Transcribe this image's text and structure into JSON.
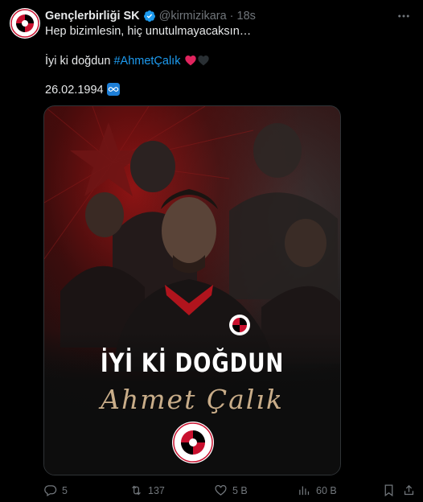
{
  "author": {
    "display_name": "Gençlerbirliği SK",
    "handle": "@kirmizikara",
    "separator": "·",
    "time": "18s",
    "verified_color": "#1d9bf0"
  },
  "tweet": {
    "line1": "Hep bizimlesin, hiç unutulmayacaksın…",
    "line2_text": "İyi ki doğdun ",
    "line2_hashtag": "#AhmetÇalık",
    "line3": "26.02.1994"
  },
  "media": {
    "headline": "İYİ Kİ DOĞDUN",
    "name_script": "Ahmet Çalık",
    "logo_text": "ANKARA GENÇLERBİRLİĞİ SPOR KULÜBÜ"
  },
  "actions": {
    "replies": "5",
    "retweets": "137",
    "likes": "5 B",
    "views": "60 B"
  },
  "colors": {
    "accent": "#1d9bf0",
    "muted": "#71767b",
    "club_red": "#c8102e",
    "club_black": "#000000"
  },
  "icons": [
    "reply-icon",
    "retweet-icon",
    "like-icon",
    "views-icon",
    "bookmark-icon",
    "share-icon",
    "more-icon",
    "verified-icon",
    "infinity-icon",
    "red-heart-icon",
    "black-heart-icon"
  ]
}
